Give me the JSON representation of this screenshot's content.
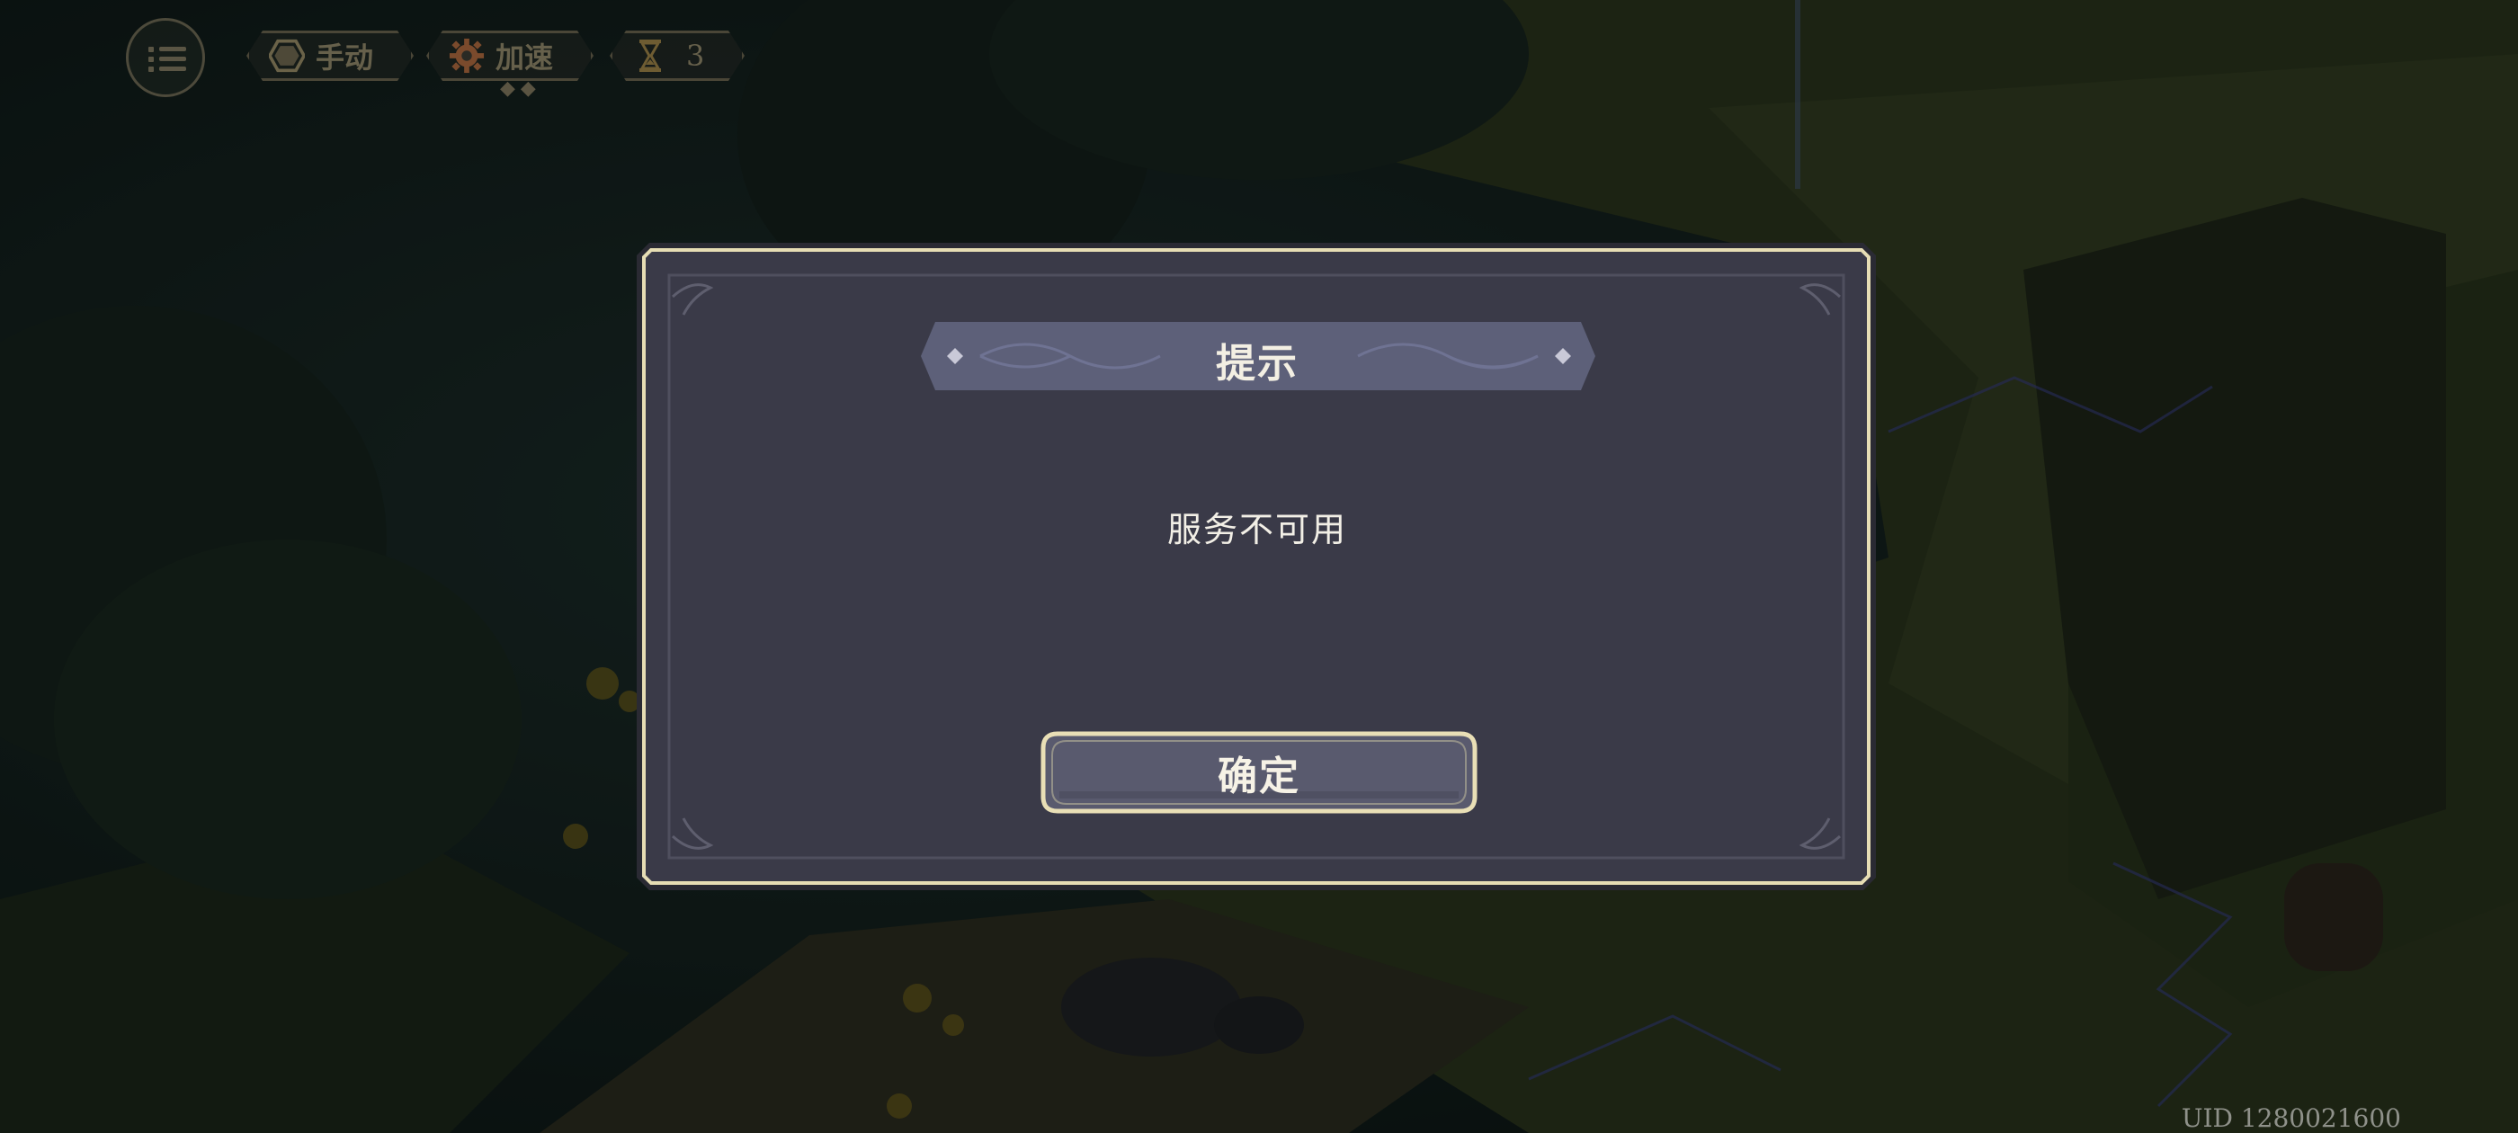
{
  "hud": {
    "menu_icon": "list-menu-icon",
    "manual_label": "手动",
    "manual_icon": "hexagon-icon",
    "speed_label": "加速",
    "speed_icon": "gear-icon",
    "speed_marks": "◆◆",
    "turn_icon": "hourglass-icon",
    "turn_count": "3"
  },
  "dialog": {
    "title": "提示",
    "message": "服务不可用",
    "confirm_label": "确定"
  },
  "footer": {
    "uid": "UID 1280021600"
  },
  "colors": {
    "dialog_bg": "#3a3a48",
    "dialog_border": "#e8dfb8",
    "title_banner": "#5d6079",
    "button_bg": "#595a6e",
    "hud_text": "#66604b"
  }
}
